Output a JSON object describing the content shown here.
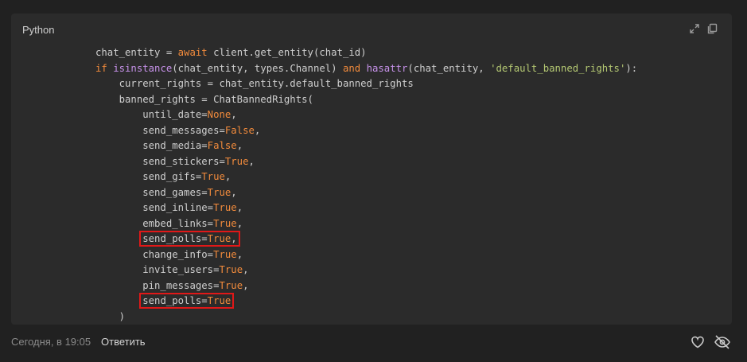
{
  "code_block": {
    "language": "Python",
    "icons": [
      "expand-icon",
      "copy-icon"
    ],
    "lines": [
      [
        {
          "t": "chat_entity = "
        },
        {
          "t": "await",
          "c": "kw"
        },
        {
          "t": " client.get_entity(chat_id)"
        }
      ],
      [
        {
          "t": "if",
          "c": "kw"
        },
        {
          "t": " "
        },
        {
          "t": "isinstance",
          "c": "bi"
        },
        {
          "t": "(chat_entity, types.Channel) "
        },
        {
          "t": "and",
          "c": "kw"
        },
        {
          "t": " "
        },
        {
          "t": "hasattr",
          "c": "bi"
        },
        {
          "t": "(chat_entity, "
        },
        {
          "t": "'default_banned_rights'",
          "c": "str"
        },
        {
          "t": "):"
        }
      ],
      [
        {
          "t": "    current_rights = chat_entity.default_banned_rights"
        }
      ],
      [
        {
          "t": "    banned_rights = ChatBannedRights("
        }
      ],
      [
        {
          "t": "        until_date="
        },
        {
          "t": "None",
          "c": "kw"
        },
        {
          "t": ","
        }
      ],
      [
        {
          "t": "        send_messages="
        },
        {
          "t": "False",
          "c": "kw"
        },
        {
          "t": ","
        }
      ],
      [
        {
          "t": "        send_media="
        },
        {
          "t": "False",
          "c": "kw"
        },
        {
          "t": ","
        }
      ],
      [
        {
          "t": "        send_stickers="
        },
        {
          "t": "True",
          "c": "kw"
        },
        {
          "t": ","
        }
      ],
      [
        {
          "t": "        send_gifs="
        },
        {
          "t": "True",
          "c": "kw"
        },
        {
          "t": ","
        }
      ],
      [
        {
          "t": "        send_games="
        },
        {
          "t": "True",
          "c": "kw"
        },
        {
          "t": ","
        }
      ],
      [
        {
          "t": "        send_inline="
        },
        {
          "t": "True",
          "c": "kw"
        },
        {
          "t": ","
        }
      ],
      [
        {
          "t": "        embed_links="
        },
        {
          "t": "True",
          "c": "kw"
        },
        {
          "t": ","
        }
      ],
      [
        {
          "t": "        "
        },
        {
          "hl": [
            {
              "t": "send_polls="
            },
            {
              "t": "True",
              "c": "kw"
            },
            {
              "t": ","
            }
          ]
        }
      ],
      [
        {
          "t": "        change_info="
        },
        {
          "t": "True",
          "c": "kw"
        },
        {
          "t": ","
        }
      ],
      [
        {
          "t": "        invite_users="
        },
        {
          "t": "True",
          "c": "kw"
        },
        {
          "t": ","
        }
      ],
      [
        {
          "t": "        pin_messages="
        },
        {
          "t": "True",
          "c": "kw"
        },
        {
          "t": ","
        }
      ],
      [
        {
          "t": "        "
        },
        {
          "hl": [
            {
              "t": "send_polls="
            },
            {
              "t": "True",
              "c": "kw"
            }
          ]
        }
      ],
      [
        {
          "t": "    )"
        }
      ]
    ]
  },
  "footer": {
    "timestamp": "Сегодня, в 19:05",
    "reply_label": "Ответить",
    "icons": [
      "heart-icon",
      "hide-eye-icon"
    ]
  },
  "colors": {
    "keyword": "#f28b3c",
    "builtin": "#c792ea",
    "string": "#b5c973",
    "highlight_box": "#e01818"
  }
}
